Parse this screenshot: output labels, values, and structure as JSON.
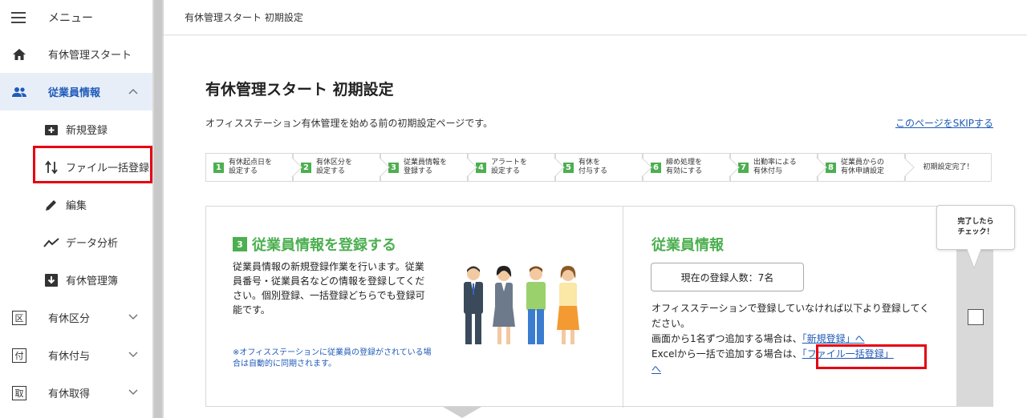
{
  "sidebar": {
    "menu_label": "メニュー",
    "items": [
      {
        "label": "有休管理スタート"
      },
      {
        "label": "従業員情報"
      },
      {
        "label": "新規登録"
      },
      {
        "label": "ファイル一括登録"
      },
      {
        "label": "編集"
      },
      {
        "label": "データ分析"
      },
      {
        "label": "有休管理簿"
      },
      {
        "label": "有休区分",
        "badge": "区"
      },
      {
        "label": "有休付与",
        "badge": "付"
      },
      {
        "label": "有休取得",
        "badge": "取"
      }
    ]
  },
  "topbar": {
    "breadcrumb": "有休管理スタート 初期設定"
  },
  "main": {
    "title": "有休管理スタート 初期設定",
    "description": "オフィスステーション有休管理を始める前の初期設定ページです。",
    "skip_link": "このページをSKIPする",
    "steps": [
      {
        "num": "1",
        "label": "有休起点日を\n設定する"
      },
      {
        "num": "2",
        "label": "有休区分を\n設定する"
      },
      {
        "num": "3",
        "label": "従業員情報を\n登録する"
      },
      {
        "num": "4",
        "label": "アラートを\n設定する"
      },
      {
        "num": "5",
        "label": "有休を\n付与する"
      },
      {
        "num": "6",
        "label": "締め処理を\n有効にする"
      },
      {
        "num": "7",
        "label": "出勤率による\n有休付与"
      },
      {
        "num": "8",
        "label": "従業員からの\n有休申請設定"
      },
      {
        "label": "初期設定完了！"
      }
    ],
    "card": {
      "step_num": "3",
      "title": "従業員情報を登録する",
      "body": "従業員情報の新規登録作業を行います。従業員番号・従業員名などの情報を登録してください。個別登録、一括登録どちらでも登録可能です。",
      "note": "※オフィスステーションに従業員の登録がされている場合は自動的に同期されます。",
      "info_title": "従業員情報",
      "count_label": "現在の登録人数：7名",
      "info_line1": "オフィスステーションで登録していなければ以下より登録してください。",
      "info_line2": "画面から1名ずつ追加する場合は、",
      "info_link1": "「新規登録」へ",
      "info_line3": "Excelから一括で追加する場合は、",
      "info_link2": "「ファイル一括登録」",
      "info_link2_tail": "へ",
      "tooltip": "完了したら\nチェック！"
    }
  },
  "colors": {
    "accent": "#1f5bb8",
    "green": "#4caf50",
    "highlight": "#e60012"
  }
}
